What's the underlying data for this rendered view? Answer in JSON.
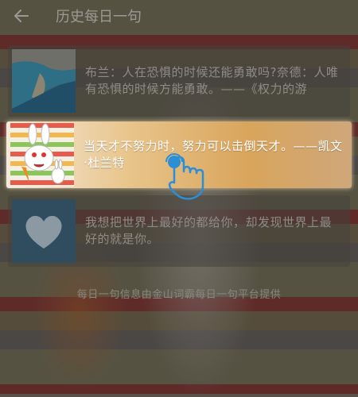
{
  "header": {
    "title": "历史每日一句",
    "back_icon": "arrow-left-icon"
  },
  "items": [
    {
      "text": "布兰：人在恐惧的时候还能勇敢吗?奈德：人唯有恐惧的时候方能勇敢。——《权力的游",
      "thumb": "coastline-photo"
    },
    {
      "text": "当天才不努力时，努力可以击倒天才。——凯文·杜兰特",
      "thumb": "rabbit-cartoon"
    },
    {
      "text": "我想把世界上最好的都给你，却发现世界上最好的就是你。",
      "thumb": "cloud-heart-photo"
    }
  ],
  "footer": {
    "text": "每日一句信息由金山词霸每日一句平台提供"
  },
  "colors": {
    "active_text": "#ffffff",
    "dim_text": "#8f8c86"
  }
}
